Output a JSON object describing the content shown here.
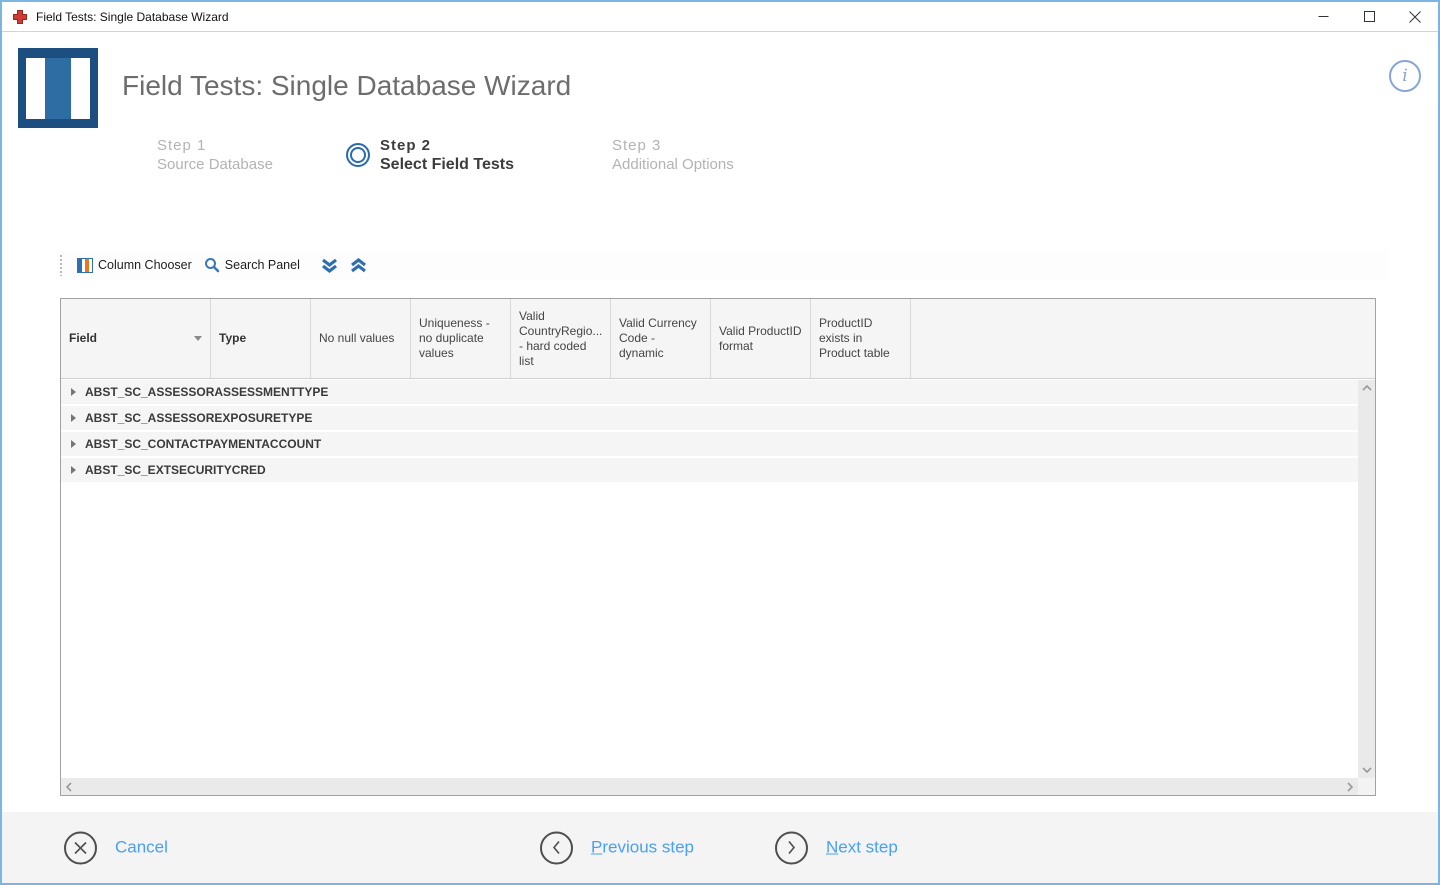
{
  "window": {
    "title": "Field Tests: Single Database Wizard"
  },
  "header": {
    "title": "Field Tests: Single Database Wizard",
    "info_icon": "i"
  },
  "steps": [
    {
      "step": "Step 1",
      "label": "Source Database",
      "active": false
    },
    {
      "step": "Step 2",
      "label": "Select Field Tests",
      "active": true
    },
    {
      "step": "Step 3",
      "label": "Additional Options",
      "active": false
    }
  ],
  "toolbar": {
    "column_chooser_label": "Column Chooser",
    "search_panel_label": "Search Panel"
  },
  "grid": {
    "columns": [
      {
        "label": "Field",
        "sorted": true
      },
      {
        "label": "Type",
        "sorted": false
      },
      {
        "label": "No null values",
        "sorted": false
      },
      {
        "label": "Uniqueness - no duplicate values",
        "sorted": false
      },
      {
        "label": "Valid CountryRegio... - hard coded list",
        "sorted": false
      },
      {
        "label": "Valid Currency Code - dynamic",
        "sorted": false
      },
      {
        "label": "Valid ProductID format",
        "sorted": false
      },
      {
        "label": "ProductID exists in Product table",
        "sorted": false
      }
    ],
    "rows": [
      "ABST_SC_ASSESSORASSESSMENTTYPE",
      "ABST_SC_ASSESSOREXPOSURETYPE",
      "ABST_SC_CONTACTPAYMENTACCOUNT",
      "ABST_SC_EXTSECURITYCRED"
    ]
  },
  "footer": {
    "cancel_label": "Cancel",
    "previous_label": "Previous step",
    "next_label": "Next step"
  },
  "colors": {
    "window_border": "#7cb5e2",
    "accent_blue": "#2e6fb0",
    "step_circle_blue": "#2a6cab",
    "link_blue": "#49a0f4",
    "brand_navy": "#1d4e80",
    "brand_blue": "#2e6da4",
    "brand_red": "#cf3c33",
    "toolbar_orange": "#e8771e",
    "grid_header_bg": "#f5f5f5",
    "row_bg": "#f5f5f5"
  }
}
